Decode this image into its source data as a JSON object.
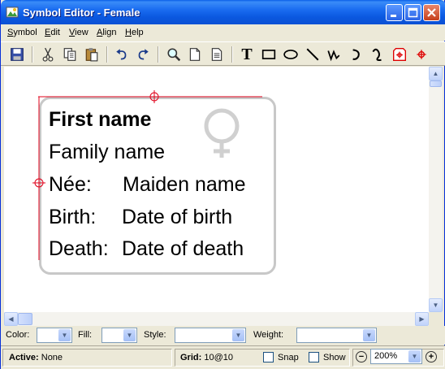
{
  "window": {
    "title": "Symbol Editor - Female"
  },
  "menu": {
    "items": [
      {
        "label": "Symbol",
        "u": "S",
        "rest": "ymbol"
      },
      {
        "label": "Edit",
        "u": "E",
        "rest": "dit"
      },
      {
        "label": "View",
        "u": "V",
        "rest": "iew"
      },
      {
        "label": "Align",
        "u": "A",
        "rest": "lign"
      },
      {
        "label": "Help",
        "u": "H",
        "rest": "elp"
      }
    ]
  },
  "toolbar": {
    "text_tool_glyph": "T",
    "icons": [
      "save-icon",
      "cut-icon",
      "copy-icon",
      "paste-icon",
      "undo-icon",
      "redo-icon",
      "zoom-icon",
      "page-icon",
      "page-icon-2",
      "text-tool-icon",
      "rectangle-tool-icon",
      "ellipse-tool-icon",
      "line-tool-icon",
      "polyline-tool-icon",
      "arc-tool-icon",
      "curve-tool-icon",
      "anchor-tool-icon",
      "crosshair-tool-icon"
    ]
  },
  "symbol": {
    "first_name": "First name",
    "family_name": "Family name",
    "nee_label": "Née:",
    "nee_value": "Maiden name",
    "birth_label": "Birth:",
    "birth_value": "Date of birth",
    "death_label": "Death:",
    "death_value": "Date of death",
    "gender_icon": "female-symbol-icon",
    "guide_color": "#e0001a"
  },
  "properties": {
    "color_label": "Color:",
    "fill_label": "Fill:",
    "style_label": "Style:",
    "weight_label": "Weight:"
  },
  "status": {
    "active_label": "Active:",
    "active_value": "None",
    "grid_label": "Grid:",
    "grid_value": "10@10",
    "snap_label": "Snap",
    "show_label": "Show",
    "zoom_value": "200%"
  },
  "colors": {
    "titlebar": "#0b58e0",
    "window_bg": "#ece9d8",
    "card_border": "#c8c8c8"
  }
}
